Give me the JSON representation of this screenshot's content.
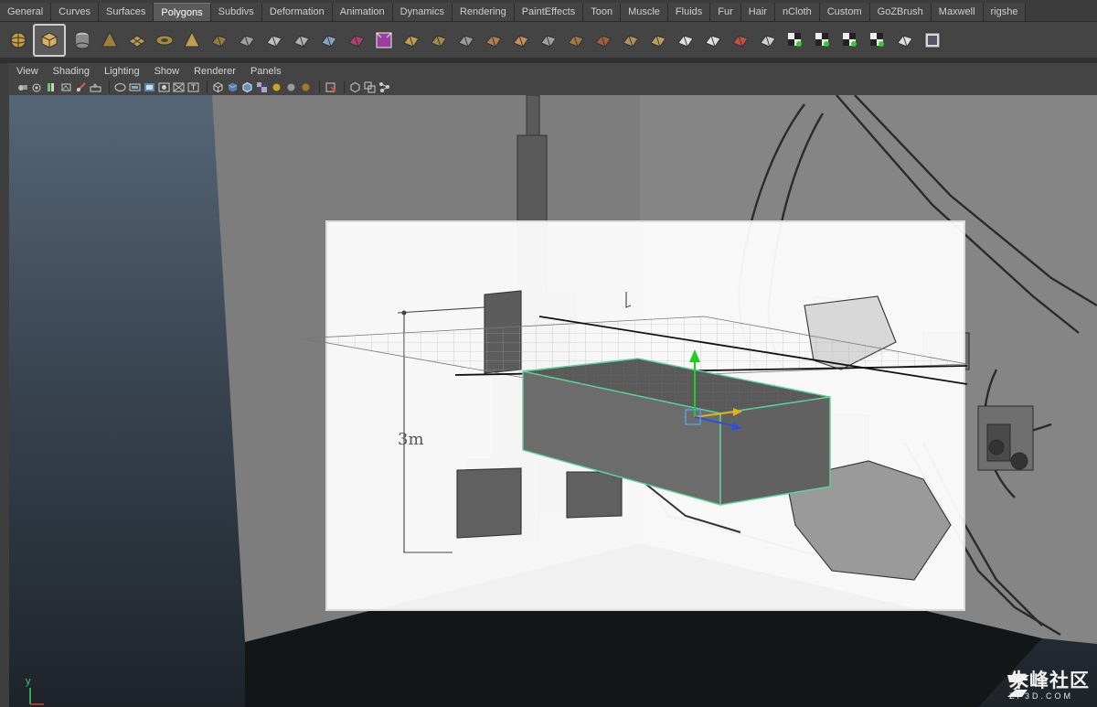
{
  "shelf_tabs": [
    "General",
    "Curves",
    "Surfaces",
    "Polygons",
    "Subdivs",
    "Deformation",
    "Animation",
    "Dynamics",
    "Rendering",
    "PaintEffects",
    "Toon",
    "Muscle",
    "Fluids",
    "Fur",
    "Hair",
    "nCloth",
    "Custom",
    "GoZBrush",
    "Maxwell",
    "rigshe"
  ],
  "active_shelf_tab": "Polygons",
  "shelf_tools": [
    "poly-sphere-icon",
    "poly-cube-icon",
    "poly-cylinder-icon",
    "poly-cone-icon",
    "poly-plane-icon",
    "poly-torus-icon",
    "poly-pyramid-icon",
    "poly-pipe-icon",
    "poly-helix-icon",
    "combine-icon",
    "separate-icon",
    "extract-icon",
    "smooth-icon",
    "boolean-icon",
    "extrude-face-icon",
    "extrude-edge-icon",
    "bridge-icon",
    "split-polygon-icon",
    "insert-edge-loop-icon",
    "offset-edge-loop-icon",
    "bevel-icon",
    "merge-icon",
    "wedge-icon",
    "poke-icon",
    "triangulate-icon",
    "quadrangulate-icon",
    "mirror-geometry-icon",
    "sculpt-geometry-icon",
    "planar-mapping-icon",
    "cylindrical-mapping-icon",
    "spherical-mapping-icon",
    "auto-mapping-icon",
    "uv-editor-icon",
    "checker-texture-icon"
  ],
  "panel_menu": [
    "View",
    "Shading",
    "Lighting",
    "Show",
    "Renderer",
    "Panels"
  ],
  "viewport": {
    "dimension_label": "3m",
    "axis_label": "y"
  },
  "watermark": {
    "title": "朱峰社区",
    "subtitle": "ZF3D.COM"
  },
  "colors": {
    "selection_outline": "#5fd59a",
    "move_y": "#22cc22",
    "move_x": "#e0b020",
    "move_z": "#3050d0",
    "viewport_top": "#556677",
    "viewport_bottom": "#1d2329"
  }
}
